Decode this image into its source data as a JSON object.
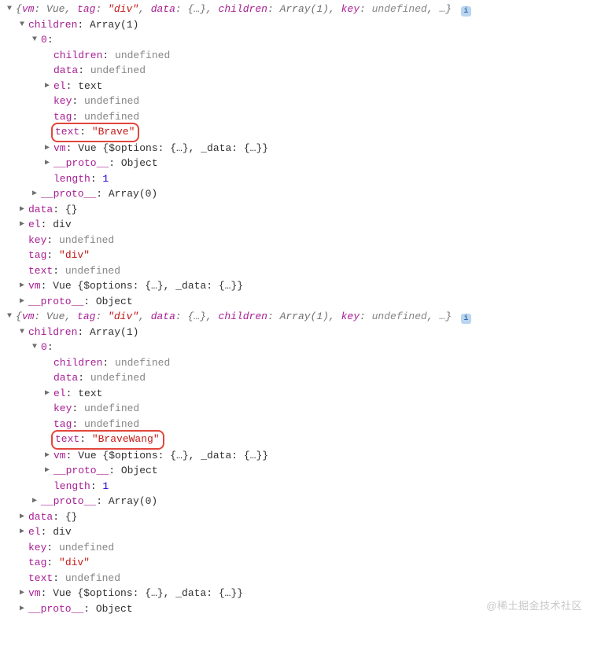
{
  "keys": {
    "vm": "vm",
    "tag": "tag",
    "data": "data",
    "children": "children",
    "key": "key",
    "el": "el",
    "text": "text",
    "proto": "__proto__",
    "length": "length",
    "zero": "0"
  },
  "vals": {
    "Vue": "Vue",
    "div_str": "\"div\"",
    "braces": "{…}",
    "emptyBraces": "{}",
    "Array1": "Array(1)",
    "Array0": "Array(0)",
    "undefined": "undefined",
    "ellipsis": "…",
    "textTok": "text",
    "divTok": "div",
    "one": "1",
    "Object": "Object",
    "VueExpanded": "Vue {$options: {…}, _data: {…}}"
  },
  "hl": {
    "brave": "\"Brave\"",
    "braveWang": "\"BraveWang\""
  },
  "info_glyph": "i",
  "watermark": "@稀土掘金技术社区"
}
